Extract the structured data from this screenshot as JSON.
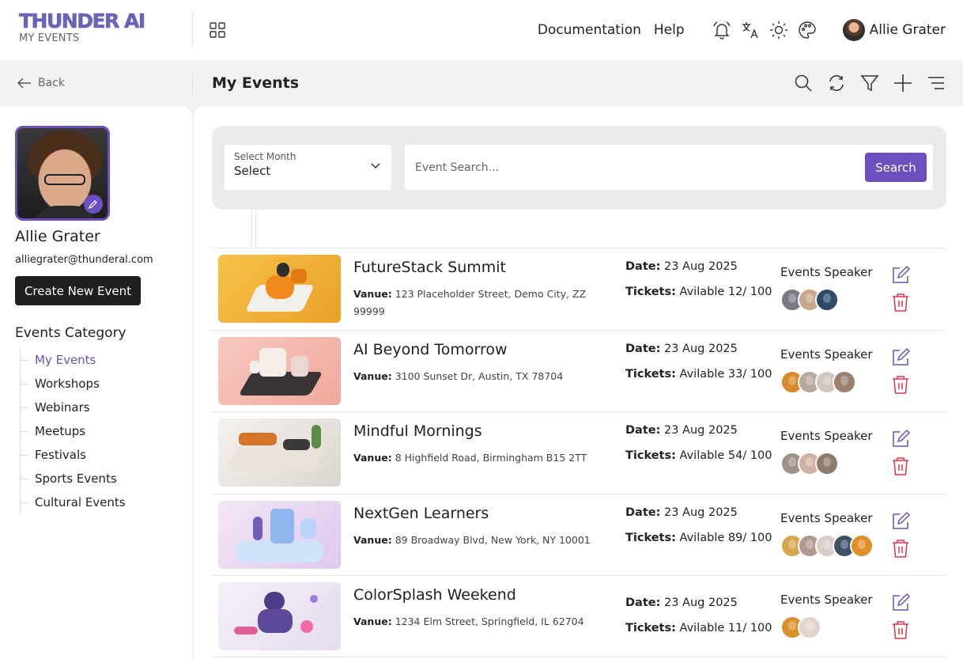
{
  "brand": {
    "logo": "THUNDER AI",
    "subtitle": "MY EVENTS"
  },
  "topnav": {
    "documentation": "Documentation",
    "help": "Help",
    "user_name": "Allie Grater"
  },
  "subheader": {
    "back_label": "Back",
    "title": "My Events"
  },
  "profile": {
    "name": "Allie Grater",
    "email": "alliegrater@thunderal.com",
    "create_label": "Create New Event"
  },
  "categories": {
    "title": "Events Category",
    "items": [
      "My Events",
      "Workshops",
      "Webinars",
      "Meetups",
      "Festivals",
      "Sports Events",
      "Cultural Events"
    ],
    "active": "My Events"
  },
  "filters": {
    "month_label": "Select Month",
    "month_value": "Select",
    "search_placeholder": "Event Search...",
    "search_button": "Search"
  },
  "labels": {
    "venue": "Vanue:",
    "date": "Date:",
    "tickets": "Tickets:",
    "speakers": "Events Speaker"
  },
  "events": [
    {
      "title": "FutureStack Summit",
      "venue": "123 Placeholder Street, Demo City, ZZ 99999",
      "date": "23 Aug 2025",
      "tickets": "Avilable 12/ 100",
      "speakers": [
        "#7a7a86",
        "#c9a58e",
        "#2e4a66"
      ]
    },
    {
      "title": "AI Beyond Tomorrow",
      "venue": "3100 Sunset Dr, Austin, TX 78704",
      "date": "23 Aug 2025",
      "tickets": "Avilable 33/ 100",
      "speakers": [
        "#d88a2a",
        "#b8a8a0",
        "#cfc7c0",
        "#9b8070"
      ]
    },
    {
      "title": "Mindful Mornings",
      "venue": "8 Highfield Road, Birmingham B15 2TT",
      "date": "23 Aug 2025",
      "tickets": "Avilable 54/ 100",
      "speakers": [
        "#a09088",
        "#d0b0a0",
        "#8f7b6d"
      ]
    },
    {
      "title": "NextGen Learners",
      "venue": "89 Broadway Blvd, New York, NY 10001",
      "date": "23 Aug 2025",
      "tickets": "Avilable 89/ 100",
      "speakers": [
        "#d6a64a",
        "#b09a90",
        "#d9cfc8",
        "#3d5268",
        "#e0902a"
      ]
    },
    {
      "title": "ColorSplash Weekend",
      "venue": "1234 Elm Street, Springfield, IL 62704",
      "date": "23 Aug 2025",
      "tickets": "Avilable 11/ 100",
      "speakers": [
        "#d98f2c",
        "#e0d4cc"
      ]
    }
  ],
  "colors": {
    "accent": "#6c50c0",
    "danger": "#e0334a",
    "dark_button": "#1f1f1f"
  }
}
